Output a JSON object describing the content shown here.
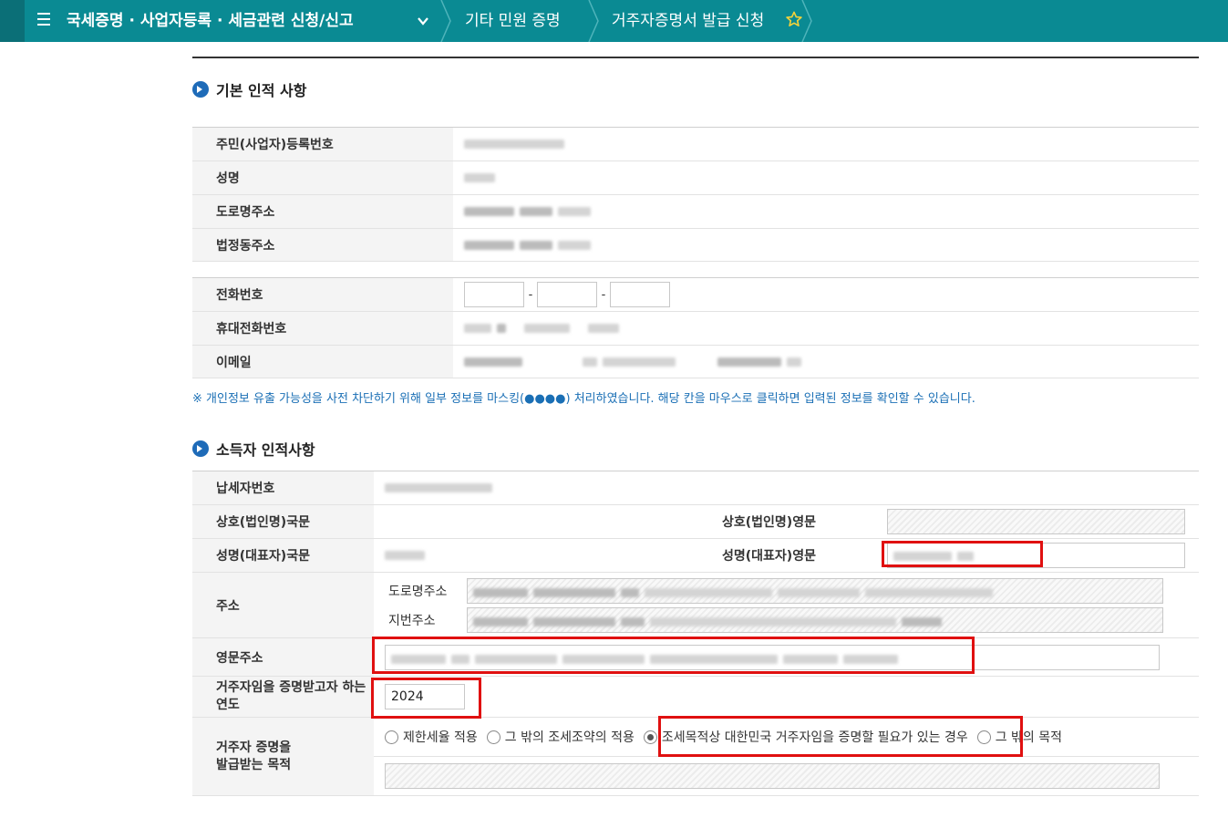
{
  "topbar": {
    "menu_icon": "hamburger-icon",
    "crumb1": "국세증명 · 사업자등록 · 세금관련 신청/신고",
    "crumb2": "기타 민원 증명",
    "crumb3": "거주자증명서 발급 신청",
    "favorite_icon": "star-icon"
  },
  "section1": {
    "title": "기본 인적 사항",
    "rows": [
      {
        "label": "주민(사업자)등록번호"
      },
      {
        "label": "성명"
      },
      {
        "label": "도로명주소"
      },
      {
        "label": "법정동주소"
      }
    ]
  },
  "section2": {
    "rows": [
      {
        "label": "전화번호"
      },
      {
        "label": "휴대전화번호"
      },
      {
        "label": "이메일"
      }
    ]
  },
  "notice": "※ 개인정보 유출 가능성을 사전 차단하기 위해 일부 정보를 마스킹(●●●●) 처리하였습니다. 해당 칸을 마우스로 클릭하면 입력된 정보를 확인할 수 있습니다.",
  "section3": {
    "title": "소득자 인적사항",
    "taxpayer_no_label": "납세자번호",
    "company_kr_label": "상호(법인명)국문",
    "company_en_label": "상호(법인명)영문",
    "name_kr_label": "성명(대표자)국문",
    "name_en_label": "성명(대표자)영문",
    "address_label": "주소",
    "road_address_label": "도로명주소",
    "lot_address_label": "지번주소",
    "eng_address_label": "영문주소",
    "year_label": "거주자임을 증명받고자 하는 연도",
    "year_value": "2024",
    "purpose_label": "거주자 증명을 발급받는 목적",
    "purpose_options": [
      "제한세율 적용",
      "그 밖의 조세조약의 적용",
      "조세목적상 대한민국 거주자임을 증명할 필요가 있는 경우",
      "그 밖의 목적"
    ],
    "purpose_selected": 2
  },
  "colors": {
    "topbar": "#0a8a93",
    "highlight_box": "#e01010",
    "notice_text": "#1a6fb5"
  }
}
